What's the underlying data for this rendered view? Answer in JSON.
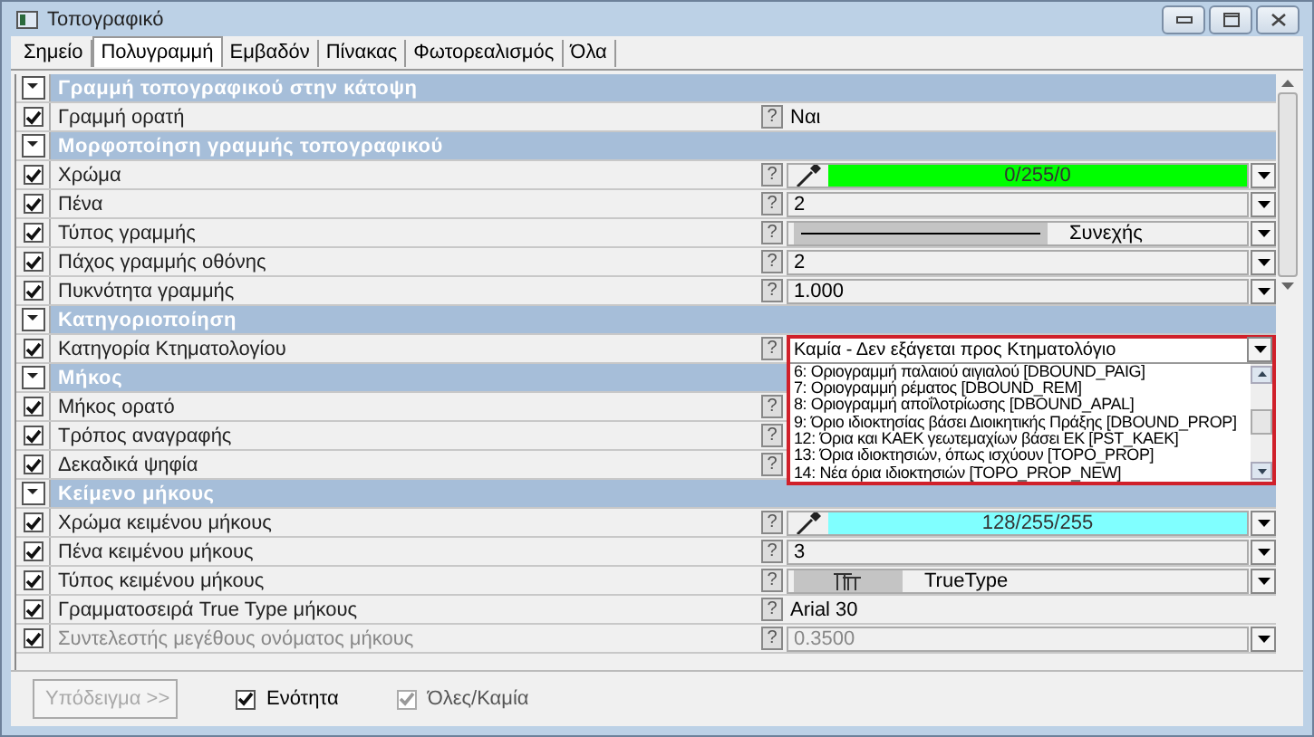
{
  "window": {
    "title": "Τοπογραφικό"
  },
  "tabs": [
    {
      "label": "Σημείο",
      "selected": false
    },
    {
      "label": "Πολυγραμμή",
      "selected": true
    },
    {
      "label": "Εμβαδόν",
      "selected": false
    },
    {
      "label": "Πίνακας",
      "selected": false
    },
    {
      "label": "Φωτορεαλισμός",
      "selected": false
    },
    {
      "label": "Όλα",
      "selected": false
    }
  ],
  "rows": [
    {
      "kind": "section",
      "label": "Γραμμή τοπογραφικού στην κάτοψη"
    },
    {
      "kind": "item",
      "label": "Γραμμή ορατή",
      "checked": true,
      "disabled": false,
      "help": "?",
      "value": {
        "kind": "text",
        "text": "Ναι"
      }
    },
    {
      "kind": "section",
      "label": "Μορφοποίηση γραμμής τοπογραφικού"
    },
    {
      "kind": "item",
      "label": "Χρώμα",
      "checked": true,
      "disabled": false,
      "help": "?",
      "value": {
        "kind": "color",
        "text": "0/255/0",
        "color": "#00ff00"
      }
    },
    {
      "kind": "item",
      "label": "Πένα",
      "checked": true,
      "disabled": false,
      "help": "?",
      "value": {
        "kind": "combo",
        "text": "2"
      }
    },
    {
      "kind": "item",
      "label": "Τύπος γραμμής",
      "checked": true,
      "disabled": false,
      "help": "?",
      "value": {
        "kind": "linetype",
        "text": "Συνεχής"
      }
    },
    {
      "kind": "item",
      "label": "Πάχος γραμμής οθόνης",
      "checked": true,
      "disabled": false,
      "help": "?",
      "value": {
        "kind": "combo",
        "text": "2"
      }
    },
    {
      "kind": "item",
      "label": "Πυκνότητα γραμμής",
      "checked": true,
      "disabled": false,
      "help": "?",
      "value": {
        "kind": "combo",
        "text": "1.000"
      }
    },
    {
      "kind": "section",
      "label": "Κατηγοριοποίηση"
    },
    {
      "kind": "item",
      "label": "Κατηγορία Κτηματολογίου",
      "checked": true,
      "disabled": false,
      "help": "?",
      "value": {
        "kind": "open-combo",
        "text": "Καμία - Δεν εξάγεται προς Κτηματολόγιο",
        "options": [
          "6: Οριογραμμή παλαιού αιγιαλού [DBOUND_PAIG]",
          "7: Οριογραμμή ρέματος [DBOUND_REM]",
          "8: Οριογραμμή αποΐλοτρίωσης [DBOUND_APAL]",
          "9: Όριο ιδιοκτησίας βάσει Διοικητικής Πράξης [DBOUND_PROP]",
          "12: Όρια και ΚΑΕΚ γεωτεμαχίων βάσει ΕΚ [PST_KAEK]",
          "13: Όρια ιδιοκτησιών, όπως ισχύουν [TOPO_PROP]",
          "14: Νέα όρια ιδιοκτησιών [TOPO_PROP_NEW]"
        ]
      }
    },
    {
      "kind": "section",
      "label": "Μήκος"
    },
    {
      "kind": "item",
      "label": "Μήκος ορατό",
      "checked": true,
      "disabled": false,
      "help": "?",
      "value": {
        "kind": "hidden"
      }
    },
    {
      "kind": "item",
      "label": "Τρόπος αναγραφής",
      "checked": true,
      "disabled": false,
      "help": "?",
      "value": {
        "kind": "hidden"
      }
    },
    {
      "kind": "item",
      "label": "Δεκαδικά ψηφία",
      "checked": true,
      "disabled": false,
      "help": "?",
      "value": {
        "kind": "hidden"
      }
    },
    {
      "kind": "section",
      "label": "Κείμενο μήκους"
    },
    {
      "kind": "item",
      "label": "Χρώμα κειμένου μήκους",
      "checked": true,
      "disabled": false,
      "help": "?",
      "value": {
        "kind": "color",
        "text": "128/255/255",
        "color": "#80ffff"
      }
    },
    {
      "kind": "item",
      "label": "Πένα κειμένου μήκους",
      "checked": true,
      "disabled": false,
      "help": "?",
      "value": {
        "kind": "combo",
        "text": "3"
      }
    },
    {
      "kind": "item",
      "label": "Τύπος κειμένου μήκους",
      "checked": true,
      "disabled": false,
      "help": "?",
      "value": {
        "kind": "font",
        "text": "TrueType"
      }
    },
    {
      "kind": "item",
      "label": "Γραμματοσειρά True Type μήκους",
      "checked": true,
      "disabled": false,
      "help": "?",
      "value": {
        "kind": "text",
        "text": "Arial 30"
      }
    },
    {
      "kind": "item",
      "label": "Συντελεστής μεγέθους ονόματος μήκους",
      "checked": true,
      "disabled": true,
      "help": "?",
      "value": {
        "kind": "combo",
        "text": "0.3500"
      }
    }
  ],
  "footer": {
    "button": {
      "label": "Υπόδειγμα >>",
      "disabled": true
    },
    "checks": [
      {
        "label": "Ενότητα",
        "checked": true,
        "disabled": false
      },
      {
        "label": "Όλες/Καμία",
        "checked": true,
        "disabled": true
      }
    ]
  }
}
